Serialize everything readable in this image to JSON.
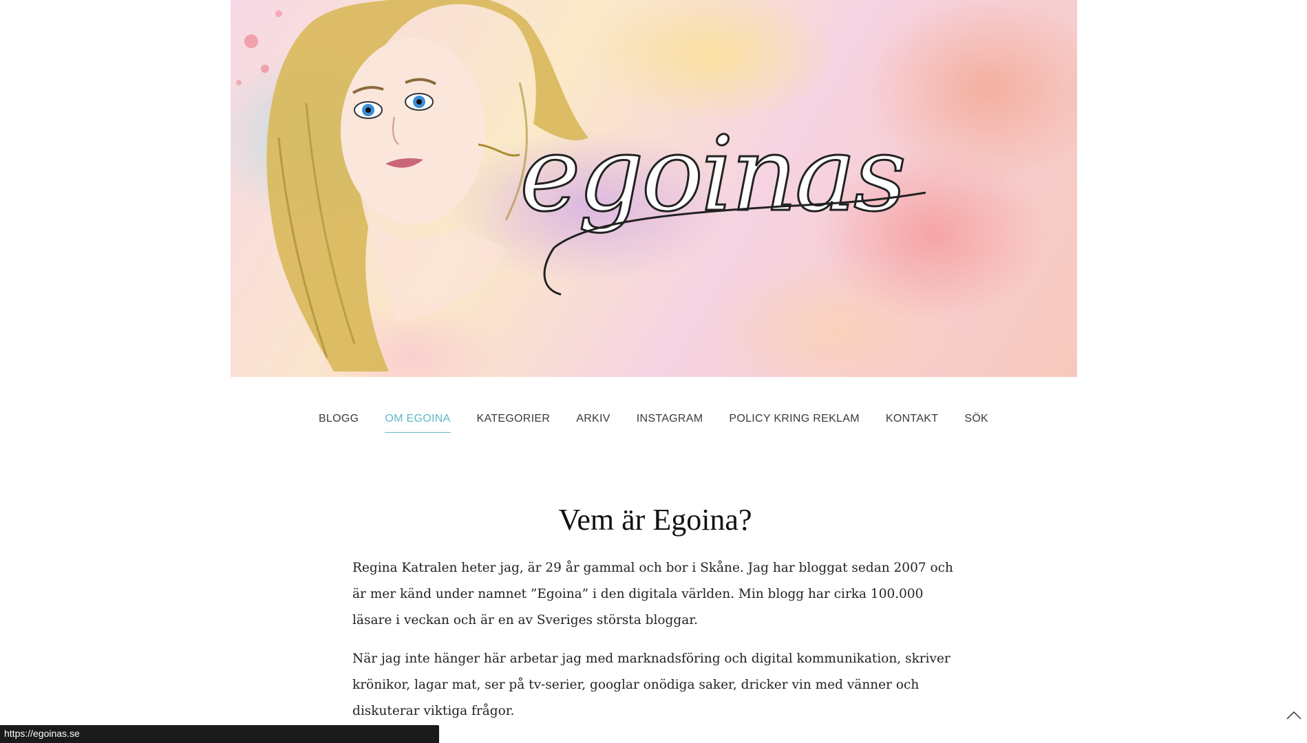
{
  "banner": {
    "logo_text": "egoinas",
    "accent_colors": [
      "#f7d8e6",
      "#fbe9c7",
      "#f7c9bd",
      "#d2aae6",
      "#aadce6"
    ]
  },
  "nav": {
    "items": [
      {
        "label": "BLOGG",
        "active": false
      },
      {
        "label": "OM EGOINA",
        "active": true
      },
      {
        "label": "KATEGORIER",
        "active": false
      },
      {
        "label": "ARKIV",
        "active": false
      },
      {
        "label": "INSTAGRAM",
        "active": false
      },
      {
        "label": "POLICY KRING REKLAM",
        "active": false
      },
      {
        "label": "KONTAKT",
        "active": false
      },
      {
        "label": "SÖK",
        "active": false
      }
    ],
    "active_color": "#5fb8c6"
  },
  "main": {
    "title": "Vem är Egoina?",
    "paragraphs": [
      "Regina Katralen heter jag, är 29 år gammal och bor i Skåne. Jag har bloggat sedan 2007 och är mer känd under namnet ”Egoina” i den digitala världen. Min blogg har cirka 100.000 läsare i veckan och är en av Sveriges största bloggar.",
      "När jag inte hänger här arbetar jag med marknadsföring och digital kommunikation, skriver krönikor, lagar mat, ser på tv-serier, googlar onödiga saker, dricker vin med vänner och diskuterar viktiga frågor."
    ]
  },
  "status": {
    "url": "https://egoinas.se"
  },
  "icons": {
    "scroll_top": "chevron-up-icon"
  }
}
